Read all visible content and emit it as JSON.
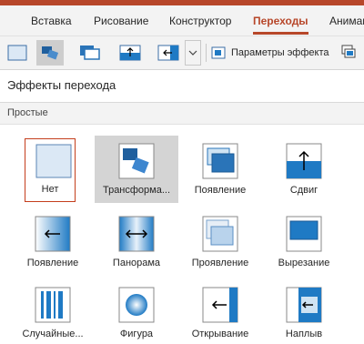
{
  "ribbon": {
    "tabs": [
      {
        "label": "Вставка"
      },
      {
        "label": "Рисование"
      },
      {
        "label": "Конструктор"
      },
      {
        "label": "Переходы",
        "active": true
      },
      {
        "label": "Анимац"
      }
    ]
  },
  "toolbar": {
    "effect_options_label": "Параметры эффекта"
  },
  "panel": {
    "title": "Эффекты перехода",
    "section": "Простые"
  },
  "gallery": [
    {
      "label": "Нет",
      "icon": "none-transition-icon"
    },
    {
      "label": "Трансформа...",
      "icon": "morph-transition-icon"
    },
    {
      "label": "Появление",
      "icon": "fade-transition-icon"
    },
    {
      "label": "Сдвиг",
      "icon": "push-transition-icon"
    },
    {
      "label": "Появление",
      "icon": "wipe-transition-icon"
    },
    {
      "label": "Панорама",
      "icon": "split-transition-icon"
    },
    {
      "label": "Проявление",
      "icon": "reveal-transition-icon"
    },
    {
      "label": "Вырезание",
      "icon": "cut-transition-icon"
    },
    {
      "label": "Случайные...",
      "icon": "random-bars-transition-icon"
    },
    {
      "label": "Фигура",
      "icon": "shape-transition-icon"
    },
    {
      "label": "Открывание",
      "icon": "uncover-transition-icon"
    },
    {
      "label": "Наплыв",
      "icon": "cover-transition-icon"
    }
  ],
  "colors": {
    "accent": "#b7472a",
    "selection_border": "#c43e1c",
    "thumb_blue": "#1f7ac4",
    "thumb_light": "#cfe3f3"
  }
}
